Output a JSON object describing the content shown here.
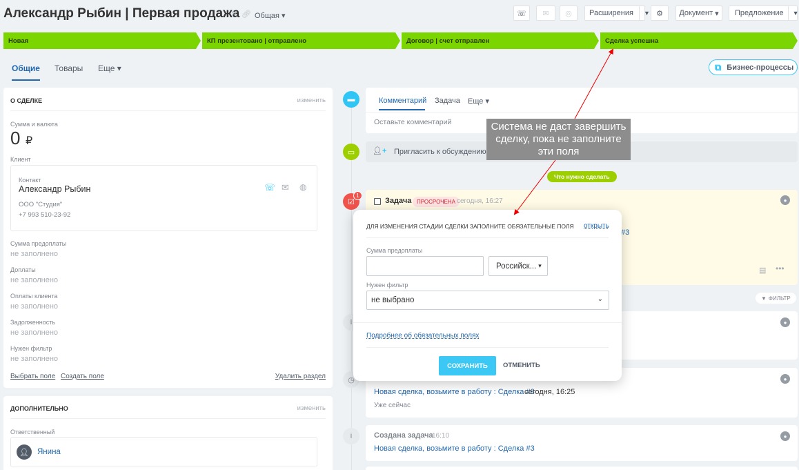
{
  "header": {
    "title": "Александр Рыбин | Первая продажа",
    "category": "Общая",
    "buttons": {
      "extensions": "Расширения",
      "document": "Документ",
      "proposal": "Предложение"
    }
  },
  "stages": [
    "Новая",
    "КП презентовано | отправлено",
    "Договор | счет отправлен",
    "Сделка успешна"
  ],
  "tabs": [
    "Общие",
    "Товары",
    "Еще"
  ],
  "business_processes": "Бизнес-процессы",
  "about": {
    "header": "О СДЕЛКЕ",
    "edit": "изменить",
    "amount_label": "Сумма и валюта",
    "amount": "0",
    "currency": "₽",
    "client_label": "Клиент",
    "contact_label": "Контакт",
    "contact_name": "Александр Рыбин",
    "company": "ООО \"Студия\"",
    "phone": "+7 993 510-23-92",
    "fields": [
      {
        "label": "Сумма предоплаты",
        "value": "не заполнено"
      },
      {
        "label": "Доплаты",
        "value": "не заполнено"
      },
      {
        "label": "Оплаты клиента",
        "value": "не заполнено"
      },
      {
        "label": "Задолженность",
        "value": "не заполнено"
      },
      {
        "label": "Нужен фильтр",
        "value": "не заполнено"
      }
    ],
    "select_field": "Выбрать поле",
    "create_field": "Создать поле",
    "delete_section": "Удалить раздел"
  },
  "additional": {
    "header": "ДОПОЛНИТЕЛЬНО",
    "edit": "изменить",
    "responsible_label": "Ответственный",
    "responsible": "Янина"
  },
  "timeline": {
    "tabs": [
      "Комментарий",
      "Задача",
      "Еще"
    ],
    "comment_placeholder": "Оставьте комментарий",
    "invite": "Пригласить к обсуждению",
    "todo_badge": "Что нужно сделать",
    "task_title": "Задача",
    "overdue": "просрочена",
    "task_time": "сегодня, 16:27",
    "task_counter": "1",
    "hash_ref": "#3",
    "filter": "ФИЛЬТР",
    "item1_link": "Новая сделка, возьмите в работу : Сделка #3",
    "item1_time": "сегодня, 16:25",
    "item1_sub": "Уже сейчас",
    "item2_title": "Создана задача",
    "item2_time": "16:10",
    "item2_link": "Новая сделка, возьмите в работу : Сделка #3"
  },
  "popup": {
    "header": "ДЛЯ ИЗМЕНЕНИЯ СТАДИИ СДЕЛКИ ЗАПОЛНИТЕ ОБЯЗАТЕЛЬНЫЕ ПОЛЯ",
    "open": "открыть",
    "prepay_label": "Сумма предоплаты",
    "prepay_value": "",
    "currency": "Российск...",
    "filter_label": "Нужен фильтр",
    "filter_value": "не выбрано",
    "more": "Подробнее об обязательных полях",
    "save": "СОХРАНИТЬ",
    "cancel": "ОТМЕНИТЬ"
  },
  "tooltip": "Система не даст завершить сделку, пока не заполните эти поля",
  "colors": {
    "stage": "#7bd500",
    "accent": "#2067b0",
    "save": "#3bc8f5",
    "overdue_bg": "#ffe4e4",
    "overdue_text": "#d2232a"
  }
}
